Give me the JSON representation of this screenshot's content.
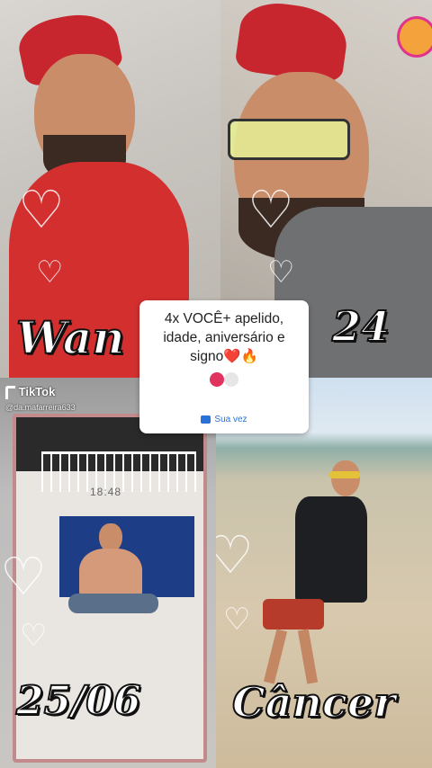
{
  "tiles": {
    "top_left_caption": "Wan",
    "top_right_caption": "24",
    "bottom_left_caption": "25/06",
    "bottom_right_caption": "Câncer"
  },
  "prompt_card": {
    "text": "4x VOCÊ+ apelido, idade, aniversário e signo❤️🔥",
    "action_label": "Sua vez"
  },
  "watermark": {
    "app": "TikTok",
    "handle": "@da.mafarreira633"
  },
  "photo_overlay": {
    "time": "18:48"
  },
  "colors": {
    "accent_blue": "#2a72d8",
    "cap_red": "#c8262f",
    "caption_fill": "#ffffff",
    "caption_stroke": "#111111"
  },
  "icons": [
    "tiktok-logo-icon",
    "heart-outline-icon",
    "camera-icon",
    "reply-icon"
  ]
}
